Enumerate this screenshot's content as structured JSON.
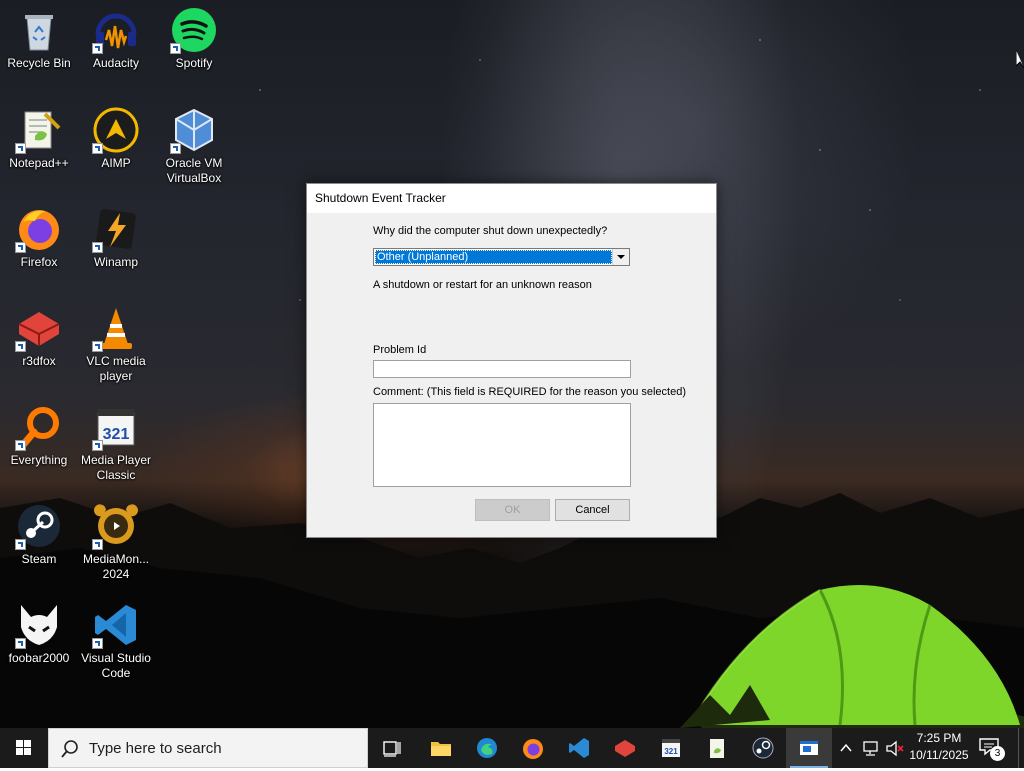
{
  "desktop_icons": [
    {
      "id": "recycle-bin",
      "label": "Recycle Bin"
    },
    {
      "id": "audacity",
      "label": "Audacity"
    },
    {
      "id": "spotify",
      "label": "Spotify"
    },
    {
      "id": "notepadpp",
      "label": "Notepad++"
    },
    {
      "id": "aimp",
      "label": "AIMP"
    },
    {
      "id": "virtualbox",
      "label": "Oracle VM VirtualBox"
    },
    {
      "id": "firefox",
      "label": "Firefox"
    },
    {
      "id": "winamp",
      "label": "Winamp"
    },
    {
      "id": "r3dfox",
      "label": "r3dfox"
    },
    {
      "id": "vlc",
      "label": "VLC media player"
    },
    {
      "id": "everything",
      "label": "Everything"
    },
    {
      "id": "mpc",
      "label": "Media Player Classic"
    },
    {
      "id": "steam",
      "label": "Steam"
    },
    {
      "id": "mediamonkey",
      "label": "MediaMon... 2024"
    },
    {
      "id": "foobar",
      "label": "foobar2000"
    },
    {
      "id": "vscode",
      "label": "Visual Studio Code"
    }
  ],
  "dialog": {
    "title": "Shutdown Event Tracker",
    "question": "Why did the computer shut down unexpectedly?",
    "reason_selected": "Other (Unplanned)",
    "reason_description": "A shutdown or restart for an unknown reason",
    "problem_id_label": "Problem Id",
    "problem_id_value": "",
    "comment_label": "Comment: (This field is REQUIRED for the reason you selected)",
    "comment_value": "",
    "ok_label": "OK",
    "cancel_label": "Cancel"
  },
  "taskbar": {
    "search_placeholder": "Type here to search",
    "pinned": [
      "task-view",
      "file-explorer",
      "edge",
      "firefox",
      "vscode",
      "r3dfox",
      "media-player-classic",
      "notepadpp",
      "steam",
      "shutdown-event-tracker"
    ],
    "clock_time": "7:25 PM",
    "clock_date": "10/11/2025",
    "notification_count": "3"
  },
  "colors": {
    "accent": "#0078d7",
    "taskbar": "#1b1b1b"
  }
}
